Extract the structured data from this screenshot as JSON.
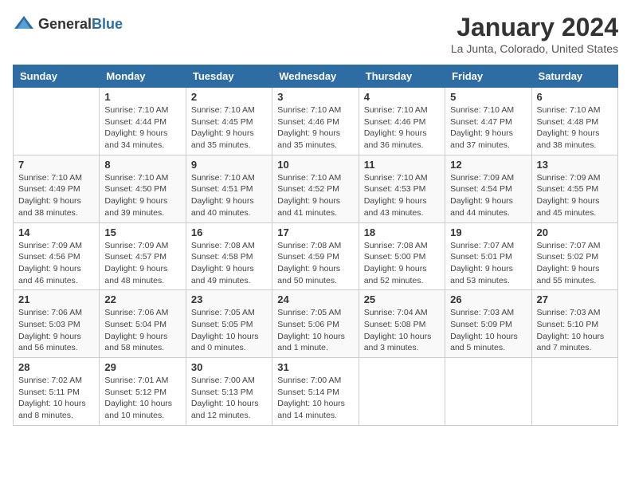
{
  "logo": {
    "general": "General",
    "blue": "Blue"
  },
  "title": "January 2024",
  "subtitle": "La Junta, Colorado, United States",
  "weekdays": [
    "Sunday",
    "Monday",
    "Tuesday",
    "Wednesday",
    "Thursday",
    "Friday",
    "Saturday"
  ],
  "weeks": [
    [
      {
        "day": "",
        "info": ""
      },
      {
        "day": "1",
        "info": "Sunrise: 7:10 AM\nSunset: 4:44 PM\nDaylight: 9 hours\nand 34 minutes."
      },
      {
        "day": "2",
        "info": "Sunrise: 7:10 AM\nSunset: 4:45 PM\nDaylight: 9 hours\nand 35 minutes."
      },
      {
        "day": "3",
        "info": "Sunrise: 7:10 AM\nSunset: 4:46 PM\nDaylight: 9 hours\nand 35 minutes."
      },
      {
        "day": "4",
        "info": "Sunrise: 7:10 AM\nSunset: 4:46 PM\nDaylight: 9 hours\nand 36 minutes."
      },
      {
        "day": "5",
        "info": "Sunrise: 7:10 AM\nSunset: 4:47 PM\nDaylight: 9 hours\nand 37 minutes."
      },
      {
        "day": "6",
        "info": "Sunrise: 7:10 AM\nSunset: 4:48 PM\nDaylight: 9 hours\nand 38 minutes."
      }
    ],
    [
      {
        "day": "7",
        "info": "Sunrise: 7:10 AM\nSunset: 4:49 PM\nDaylight: 9 hours\nand 38 minutes."
      },
      {
        "day": "8",
        "info": "Sunrise: 7:10 AM\nSunset: 4:50 PM\nDaylight: 9 hours\nand 39 minutes."
      },
      {
        "day": "9",
        "info": "Sunrise: 7:10 AM\nSunset: 4:51 PM\nDaylight: 9 hours\nand 40 minutes."
      },
      {
        "day": "10",
        "info": "Sunrise: 7:10 AM\nSunset: 4:52 PM\nDaylight: 9 hours\nand 41 minutes."
      },
      {
        "day": "11",
        "info": "Sunrise: 7:10 AM\nSunset: 4:53 PM\nDaylight: 9 hours\nand 43 minutes."
      },
      {
        "day": "12",
        "info": "Sunrise: 7:09 AM\nSunset: 4:54 PM\nDaylight: 9 hours\nand 44 minutes."
      },
      {
        "day": "13",
        "info": "Sunrise: 7:09 AM\nSunset: 4:55 PM\nDaylight: 9 hours\nand 45 minutes."
      }
    ],
    [
      {
        "day": "14",
        "info": "Sunrise: 7:09 AM\nSunset: 4:56 PM\nDaylight: 9 hours\nand 46 minutes."
      },
      {
        "day": "15",
        "info": "Sunrise: 7:09 AM\nSunset: 4:57 PM\nDaylight: 9 hours\nand 48 minutes."
      },
      {
        "day": "16",
        "info": "Sunrise: 7:08 AM\nSunset: 4:58 PM\nDaylight: 9 hours\nand 49 minutes."
      },
      {
        "day": "17",
        "info": "Sunrise: 7:08 AM\nSunset: 4:59 PM\nDaylight: 9 hours\nand 50 minutes."
      },
      {
        "day": "18",
        "info": "Sunrise: 7:08 AM\nSunset: 5:00 PM\nDaylight: 9 hours\nand 52 minutes."
      },
      {
        "day": "19",
        "info": "Sunrise: 7:07 AM\nSunset: 5:01 PM\nDaylight: 9 hours\nand 53 minutes."
      },
      {
        "day": "20",
        "info": "Sunrise: 7:07 AM\nSunset: 5:02 PM\nDaylight: 9 hours\nand 55 minutes."
      }
    ],
    [
      {
        "day": "21",
        "info": "Sunrise: 7:06 AM\nSunset: 5:03 PM\nDaylight: 9 hours\nand 56 minutes."
      },
      {
        "day": "22",
        "info": "Sunrise: 7:06 AM\nSunset: 5:04 PM\nDaylight: 9 hours\nand 58 minutes."
      },
      {
        "day": "23",
        "info": "Sunrise: 7:05 AM\nSunset: 5:05 PM\nDaylight: 10 hours\nand 0 minutes."
      },
      {
        "day": "24",
        "info": "Sunrise: 7:05 AM\nSunset: 5:06 PM\nDaylight: 10 hours\nand 1 minute."
      },
      {
        "day": "25",
        "info": "Sunrise: 7:04 AM\nSunset: 5:08 PM\nDaylight: 10 hours\nand 3 minutes."
      },
      {
        "day": "26",
        "info": "Sunrise: 7:03 AM\nSunset: 5:09 PM\nDaylight: 10 hours\nand 5 minutes."
      },
      {
        "day": "27",
        "info": "Sunrise: 7:03 AM\nSunset: 5:10 PM\nDaylight: 10 hours\nand 7 minutes."
      }
    ],
    [
      {
        "day": "28",
        "info": "Sunrise: 7:02 AM\nSunset: 5:11 PM\nDaylight: 10 hours\nand 8 minutes."
      },
      {
        "day": "29",
        "info": "Sunrise: 7:01 AM\nSunset: 5:12 PM\nDaylight: 10 hours\nand 10 minutes."
      },
      {
        "day": "30",
        "info": "Sunrise: 7:00 AM\nSunset: 5:13 PM\nDaylight: 10 hours\nand 12 minutes."
      },
      {
        "day": "31",
        "info": "Sunrise: 7:00 AM\nSunset: 5:14 PM\nDaylight: 10 hours\nand 14 minutes."
      },
      {
        "day": "",
        "info": ""
      },
      {
        "day": "",
        "info": ""
      },
      {
        "day": "",
        "info": ""
      }
    ]
  ]
}
